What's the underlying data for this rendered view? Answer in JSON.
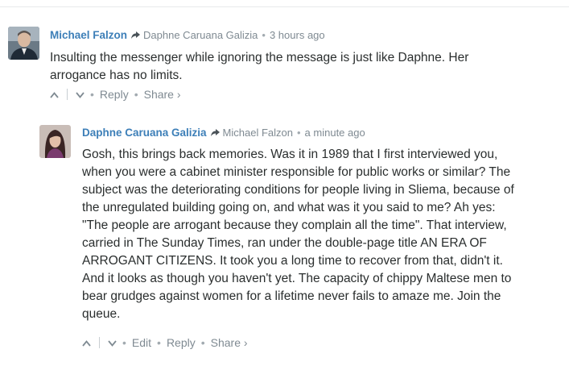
{
  "comments": [
    {
      "author": "Michael Falzon",
      "reply_to": "Daphne Caruana Galizia",
      "time": "3 hours ago",
      "lines": [
        "Insulting the messenger while ignoring the message is just like Daphne. Her",
        "arrogance has no limits."
      ],
      "actions": {
        "reply": "Reply",
        "share": "Share ›"
      }
    },
    {
      "author": "Daphne Caruana Galizia",
      "reply_to": "Michael Falzon",
      "time": "a minute ago",
      "lines": [
        "Gosh, this brings back memories. Was it in 1989 that I first interviewed you,",
        "when you were a cabinet minister responsible for public works or similar? The",
        "subject was the deteriorating conditions for people living in Sliema, because of",
        "the unregulated building going on, and what was it you said to me? Ah yes:",
        "\"The people are arrogant because they complain all the time\". That interview,",
        "carried in The Sunday Times, ran under the double-page title AN ERA OF",
        "ARROGANT CITIZENS. It took you a long time to recover from that, didn't it.",
        "And it looks as though you haven't yet. The capacity of chippy Maltese men to",
        "bear grudges against women for a lifetime never fails to amaze me. Join the",
        "queue."
      ],
      "actions": {
        "edit": "Edit",
        "reply": "Reply",
        "share": "Share ›"
      }
    }
  ],
  "colors": {
    "author": "#3d7fb8",
    "meta": "#7f8a92",
    "text": "#2a2e2e"
  },
  "icons": [
    "upvote-icon",
    "downvote-icon",
    "reply-arrow-icon"
  ]
}
